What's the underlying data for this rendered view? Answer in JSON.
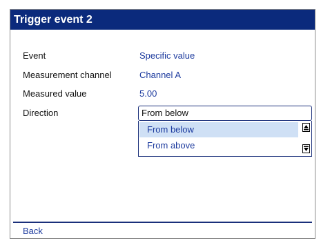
{
  "window": {
    "title": "Trigger event 2"
  },
  "fields": [
    {
      "label": "Event",
      "value": "Specific value"
    },
    {
      "label": "Measurement channel",
      "value": "Channel A"
    },
    {
      "label": "Measured value",
      "value": "5.00"
    },
    {
      "label": "Direction"
    }
  ],
  "direction_dropdown": {
    "selected": "From below",
    "options": [
      "From below",
      "From above"
    ],
    "highlighted_option": "From below"
  },
  "footer": {
    "back_label": "Back"
  },
  "icons": {
    "scroll_up": "scroll-up-arrow-icon",
    "scroll_down": "scroll-down-arrow-icon"
  },
  "colors": {
    "title_bar": "#0b2a7c",
    "value_text": "#1c3a9e",
    "highlight": "#cfe0f5"
  }
}
